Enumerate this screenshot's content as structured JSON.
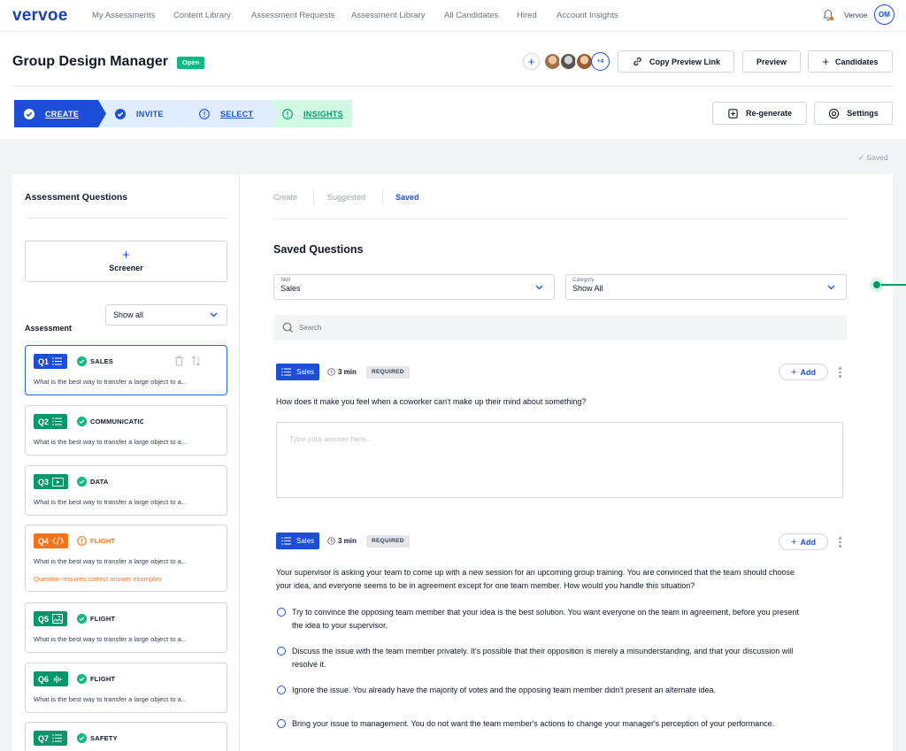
{
  "nav": {
    "logo": "vervoe",
    "items": [
      "My Assessments",
      "Content Library",
      "Assessment Requests",
      "Assessment Library",
      "All Candidates",
      "Hired",
      "Account Insights"
    ],
    "user_name": "Vervoe",
    "user_initials": "OM",
    "icons": [
      "bell-icon"
    ]
  },
  "header": {
    "title": "Group Design Manager",
    "status": "Open",
    "collaborators_more": "+4",
    "copy_link_label": "Copy Preview Link",
    "preview_label": "Preview",
    "candidates_label": "Candidates"
  },
  "steps": [
    {
      "label": "CREATE",
      "state": "complete"
    },
    {
      "label": "INVITE",
      "state": "complete"
    },
    {
      "label": "SELECT",
      "state": "warning"
    },
    {
      "label": "INSIGHTS",
      "state": "warning"
    }
  ],
  "actions": {
    "regenerate_label": "Re-generate",
    "settings_label": "Settings"
  },
  "saved_status": "Saved",
  "sidebar": {
    "title": "Assessment Questions",
    "screener_label": "Screener",
    "filter_value": "Show all",
    "assessment_label": "Assessment",
    "questions": [
      {
        "num": "Q1",
        "skill": "SALES",
        "text": "What is the best way to transfer a large object to a...",
        "color": "#1d4ed8",
        "status": "ok",
        "icon": "list-icon"
      },
      {
        "num": "Q2",
        "skill": "COMMUNICATION",
        "text": "What is the best way to transfer a large object to a...",
        "color": "#059669",
        "status": "ok",
        "icon": "list-icon"
      },
      {
        "num": "Q3",
        "skill": "DATA",
        "text": "What is the best way to transfer a large object to a...",
        "color": "#059669",
        "status": "ok",
        "icon": "video-icon"
      },
      {
        "num": "Q4",
        "skill": "FLIGHT",
        "text": "What is the best way to transfer a large object to a...",
        "color": "#f97316",
        "status": "warning",
        "icon": "code-icon",
        "warning": "Question requires correct answer examples"
      },
      {
        "num": "Q5",
        "skill": "FLIGHT",
        "text": "What is the best way to transfer a large object to a...",
        "color": "#059669",
        "status": "ok",
        "icon": "image-icon"
      },
      {
        "num": "Q6",
        "skill": "FLIGHT",
        "text": "What is the best way to transfer a large object to a...",
        "color": "#059669",
        "status": "ok",
        "icon": "audio-icon"
      },
      {
        "num": "Q7",
        "skill": "SAFETY",
        "text": "",
        "color": "#059669",
        "status": "ok",
        "icon": "list-icon"
      }
    ]
  },
  "main": {
    "tabs": [
      {
        "label": "Create"
      },
      {
        "label": "Suggested"
      },
      {
        "label": "Saved",
        "active": true
      }
    ],
    "title": "Saved Questions",
    "skill_filter": {
      "label": "Skill",
      "value": "Sales"
    },
    "category_filter": {
      "label": "Category",
      "value": "Show All"
    },
    "search_placeholder": "Search",
    "cards": [
      {
        "skill": "Sales",
        "time": "3 min",
        "required": "REQUIRED",
        "add_label": "Add",
        "prompt": "How does it make you feel when a coworker can't make up their mind about something?",
        "answer_placeholder": "Type your answer here..."
      },
      {
        "skill": "Sales",
        "time": "3 min",
        "required": "REQUIRED",
        "add_label": "Add",
        "prompt_line1": "Your supervisor is asking your team to come up with a new session for an upcoming group training. You are convinced that the team should choose",
        "prompt_line2": "your idea, and everyone seems to be in agreement except for one team member. How would you handle this situation?",
        "options": [
          {
            "line1": "Try to convince the opposing team member that your idea is the best solution. You want everyone on the team in agreement, before you present",
            "line2": "the idea to your supervisor."
          },
          {
            "line1": "Discuss the issue with the team member privately. It's possible that their opposition is merely a misunderstanding, and that your discussion will",
            "line2": "resolve it."
          },
          {
            "line1": "Ignore the issue. You already have the majority of votes and the opposing team member didn't present an alternate idea.",
            "line2": ""
          },
          {
            "line1": "Bring your issue to management. You do not want the team member's actions to change your manager's perception of your performance.",
            "line2": ""
          }
        ]
      }
    ]
  },
  "colors": {
    "primary": "#1d4ed8",
    "success": "#10b981",
    "warning": "#f97316",
    "insights_bg": "#d1fae5"
  }
}
